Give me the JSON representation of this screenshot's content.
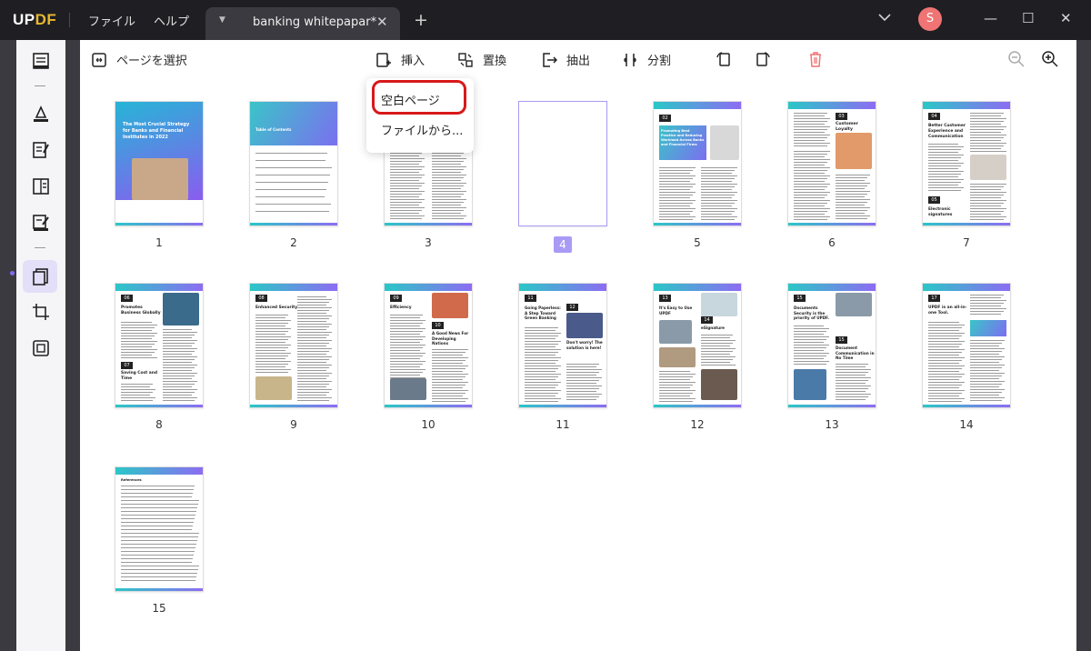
{
  "titlebar": {
    "logo_a": "UP",
    "logo_b": "DF",
    "menu_file": "ファイル",
    "menu_help": "ヘルプ",
    "tab_title": "banking whitepapar*",
    "avatar": "S"
  },
  "toolbar": {
    "select_pages": "ページを選択",
    "insert": "挿入",
    "replace": "置換",
    "extract": "抽出",
    "split": "分割"
  },
  "dropdown": {
    "blank_page": "空白ページ",
    "from_file": "ファイルから..."
  },
  "pages": [
    "1",
    "2",
    "3",
    "4",
    "5",
    "6",
    "7",
    "8",
    "9",
    "10",
    "11",
    "12",
    "13",
    "14",
    "15"
  ],
  "selected_page": "4",
  "thumbs": {
    "p1_title": "The Most Crucial Strategy for Banks and Financial Institutes in 2022",
    "p2_title": "Table of Contents",
    "p5_title": "Promoting Best Practice and Reducing Workload Across Banks and Financial Firms",
    "p6_title": "Customer Loyalty",
    "p7_title_a": "Better Customer Experience and Communication",
    "p7_title_b": "Electronic signatures",
    "p8_title_a": "Promotes Business Globally",
    "p8_title_b": "Saving Cost and Time",
    "p9_title": "Enhanced Security",
    "p10_title_a": "Efficiency",
    "p10_title_b": "A Good News For Developing Nations",
    "p11_title_a": "Going Paperless: A Step Toward Green Banking",
    "p11_title_b": "Don't worry! The solution is here!",
    "p12_title_a": "It's Easy to Use UPDF",
    "p12_title_b": "eSignature",
    "p13_title_a": "Documents Security is the priority of UPDF.",
    "p13_title_b": "Document Communication in No Time",
    "p14_title": "UPDF is an all-in-one Tool.",
    "p15_title": "References",
    "badges": [
      "02",
      "03",
      "04",
      "05",
      "06",
      "07",
      "08",
      "09",
      "10",
      "11",
      "12",
      "13",
      "14",
      "15",
      "16",
      "17"
    ]
  },
  "colors": {
    "accent": "#a99bf5",
    "highlight": "#d81818",
    "delete": "#f07474"
  }
}
